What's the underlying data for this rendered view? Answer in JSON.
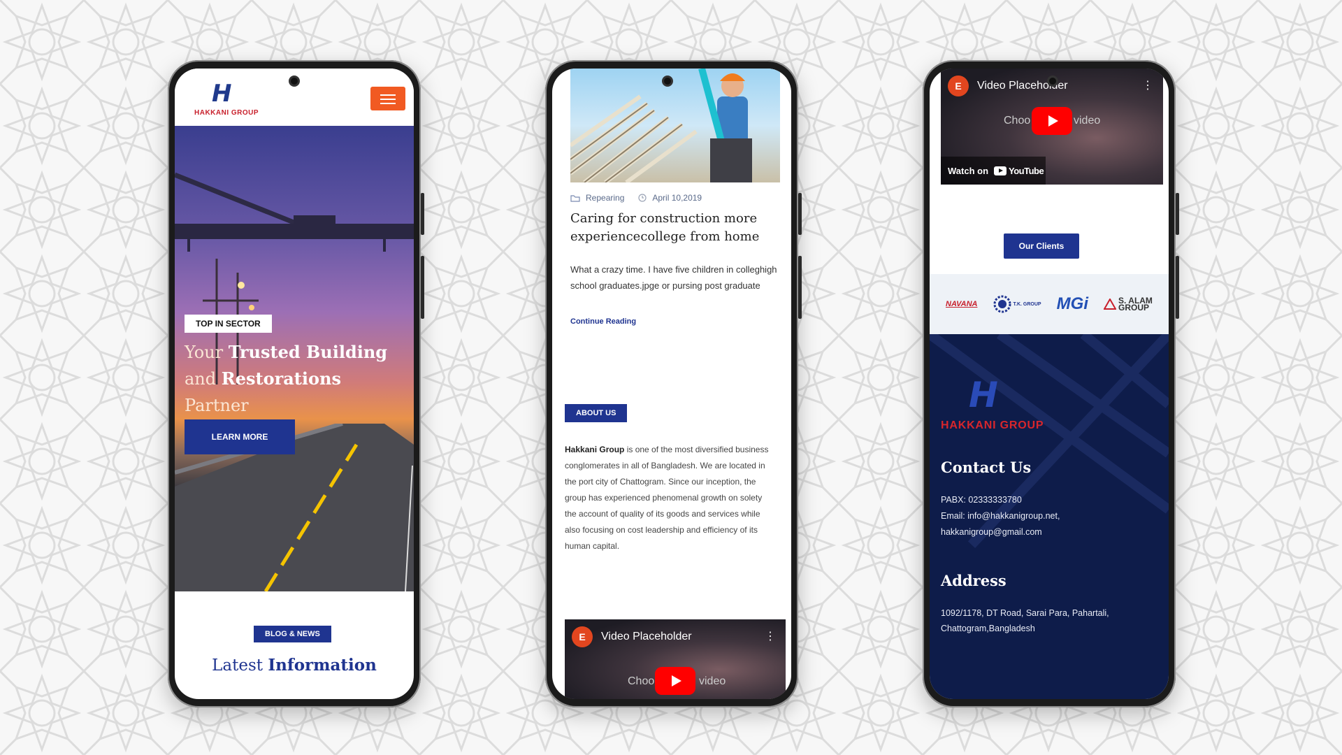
{
  "phone1": {
    "logo_word": "HAKKANI GROUP",
    "hero": {
      "badge": "TOP IN SECTOR",
      "title_line1_light": "Your ",
      "title_line1_bold": "Trusted Building",
      "title_line2_light": "and ",
      "title_line2_bold": "Restorations",
      "title_line2_tail": " Partner",
      "button": "LEARN MORE"
    },
    "blog_tag": "BLOG & NEWS",
    "latest_light": "Latest ",
    "latest_bold": "Information"
  },
  "phone2": {
    "post": {
      "category": "Repearing",
      "date": "April 10,2019",
      "title": "Caring for construction more experiencecollege from home",
      "excerpt": "What a crazy time. I have five children in colleghigh school graduates.jpge or pursing post graduate",
      "continue": "Continue Reading"
    },
    "about_tag": "ABOUT US",
    "about_company": "Hakkani Group",
    "about_text": " is one of the most diversified business conglomerates in all of Bangladesh. We are located in the port city of Chattogram. Since our inception, the group has experienced phenomenal growth on solety the account of quality of its goods and services while also focusing on cost leadership and efficiency of its human capital.",
    "video": {
      "channel_icon": "E",
      "title": "Video Placeholder",
      "choose_left": "Choo",
      "choose_right": "video"
    }
  },
  "phone3": {
    "video": {
      "channel_icon": "E",
      "title": "Video Placeholder",
      "choose_left": "Choo",
      "choose_right": "video",
      "watch_on": "Watch on",
      "youtube": "YouTube"
    },
    "clients_button": "Our Clients",
    "clients": [
      "NAVANA",
      "T.K. GROUP",
      "MGi",
      "S. ALAM",
      "GROUP"
    ],
    "footer": {
      "logo_word": "HAKKANI GROUP",
      "contact_heading": "Contact Us",
      "pabx": "PABX: 02333333780",
      "email": "Email: info@hakkanigroup.net,",
      "email2": "hakkanigroup@gmail.com",
      "address_heading": "Address",
      "address1": "1092/1178, DT Road, Sarai Para, Pahartali,",
      "address2": "Chattogram,Bangladesh"
    }
  },
  "colors": {
    "brand_blue": "#1f3490",
    "brand_orange": "#f15a22",
    "brand_red": "#c8202c",
    "footer_navy": "#0e1c4a",
    "youtube_red": "#ff0000"
  }
}
